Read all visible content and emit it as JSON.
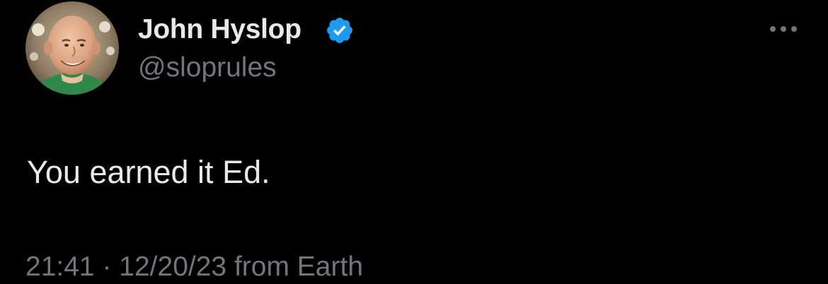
{
  "user": {
    "display_name": "John Hyslop",
    "handle": "@sloprules",
    "verified": true,
    "avatar_description": "profile photo of smiling bald man in green shirt"
  },
  "tweet": {
    "text": "You earned it Ed."
  },
  "meta": {
    "time": "21:41",
    "separator": "·",
    "date": "12/20/23",
    "source": "from Earth"
  },
  "colors": {
    "background": "#000000",
    "primary_text": "#e7e9ea",
    "secondary_text": "#71767b",
    "verified_badge": "#1d9bf0"
  },
  "icons": {
    "verified": "verified-badge-icon",
    "more": "more-horizontal-icon"
  }
}
